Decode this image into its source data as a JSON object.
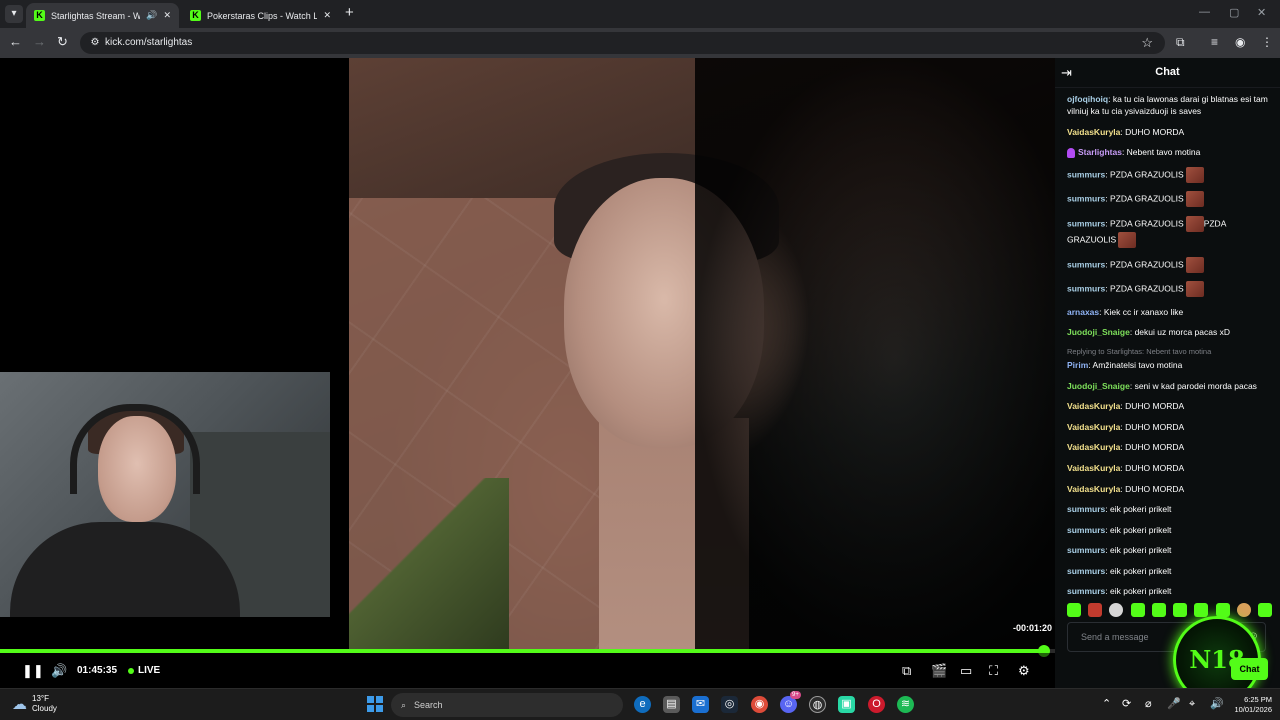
{
  "browser": {
    "tabs": [
      {
        "title": "Starlightas Stream - Watch Live on Kick",
        "favicon": "kick-icon",
        "audio": "speaker-icon",
        "active": true
      },
      {
        "title": "Pokerstaras Clips - Watch Live on Kick",
        "favicon": "kick-icon",
        "active": false
      }
    ],
    "address": "kick.com/starlightas",
    "favicon_letter": "K"
  },
  "player": {
    "time_remaining": "-00:01:20",
    "elapsed": "01:45:35",
    "live_label": "LIVE",
    "progress": 0.99
  },
  "chat": {
    "title": "Chat",
    "messages": [
      {
        "user": "ojfoqihoiq",
        "color": "cyan",
        "text": "ka tu cia lawonas darai gi blatnas esi tam vilniuj ka tu cia ysivaizduoji is saves"
      },
      {
        "user": "VaidasKuryla",
        "color": "yellow",
        "text": "DUHO MORDA"
      },
      {
        "user": "Starlightas",
        "color": "purple",
        "badge": true,
        "text": "Nebent tavo motina"
      },
      {
        "user": "summurs",
        "color": "cyan",
        "text": "PZDA GRAZUOLIS",
        "emotes": 1
      },
      {
        "user": "summurs",
        "color": "cyan",
        "text": "PZDA GRAZUOLIS",
        "emotes": 1
      },
      {
        "user": "summurs",
        "color": "cyan",
        "text": "PZDA GRAZUOLIS",
        "emotes": 1,
        "tail": "PZDA GRAZUOLIS",
        "tail_emotes": 1
      },
      {
        "user": "summurs",
        "color": "cyan",
        "text": "PZDA GRAZUOLIS",
        "emotes": 1
      },
      {
        "user": "summurs",
        "color": "cyan",
        "text": "PZDA GRAZUOLIS",
        "emotes": 1
      },
      {
        "user": "arnaxas",
        "color": "blue",
        "text": "Kiek cc ir xanaxo like"
      },
      {
        "user": "Juodoji_Snaige",
        "color": "green",
        "text": "dekui uz morca pacas xD"
      },
      {
        "reply": "Replying to Starlightas: Nebent tavo motina",
        "user": "Pirim",
        "color": "blue",
        "text": "Amžinatelsi tavo motina"
      },
      {
        "user": "Juodoji_Snaige",
        "color": "green",
        "text": "seni w kad parodei morda pacas"
      },
      {
        "user": "VaidasKuryla",
        "color": "yellow",
        "text": "DUHO MORDA"
      },
      {
        "user": "VaidasKuryla",
        "color": "yellow",
        "text": "DUHO MORDA"
      },
      {
        "user": "VaidasKuryla",
        "color": "yellow",
        "text": "DUHO MORDA"
      },
      {
        "user": "VaidasKuryla",
        "color": "yellow",
        "text": "DUHO MORDA"
      },
      {
        "user": "VaidasKuryla",
        "color": "yellow",
        "text": "DUHO MORDA"
      },
      {
        "user": "summurs",
        "color": "cyan",
        "text": "eik pokeri prikelt"
      },
      {
        "user": "summurs",
        "color": "cyan",
        "text": "eik pokeri prikelt"
      },
      {
        "user": "summurs",
        "color": "cyan",
        "text": "eik pokeri prikelt"
      },
      {
        "user": "summurs",
        "color": "cyan",
        "text": "eik pokeri prikelt"
      },
      {
        "user": "summurs",
        "color": "cyan",
        "text": "eik pokeri prikelt"
      }
    ],
    "input_placeholder": "Send a message",
    "send_label": "Chat",
    "overlay_text": "N18"
  },
  "taskbar": {
    "weather_temp": "13°F",
    "weather_desc": "Cloudy",
    "search_placeholder": "Search",
    "time": "6:25 PM",
    "date": "10/01/2026",
    "notification_count": "9+"
  },
  "colors": {
    "kick_green": "#53fc18",
    "chat_bg": "#0b0e0f"
  }
}
